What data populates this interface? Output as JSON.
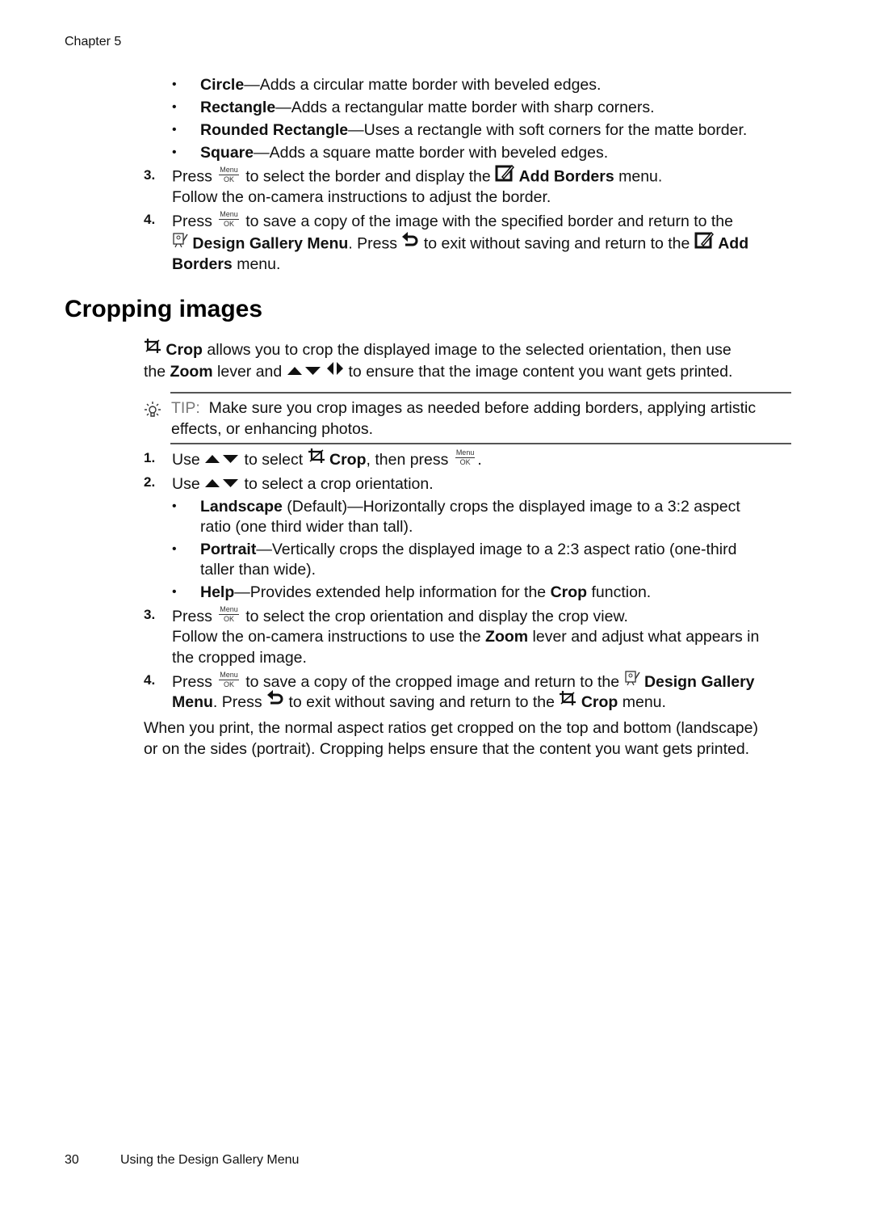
{
  "header": {
    "chapter": "Chapter 5"
  },
  "borders_section": {
    "bullets": [
      {
        "term": "Circle",
        "desc": "—Adds a circular matte border with beveled edges."
      },
      {
        "term": "Rectangle",
        "desc": "—Adds a rectangular matte border with sharp corners."
      },
      {
        "term": "Rounded Rectangle",
        "desc": "—Uses a rectangle with soft corners for the matte border."
      },
      {
        "term": "Square",
        "desc": "—Adds a square matte border with beveled edges."
      }
    ],
    "step3": {
      "num": "3.",
      "press": "Press",
      "after_button": "to select the border and display the",
      "menu_name": "Add Borders",
      "menu_suffix": "menu.",
      "line2": "Follow the on-camera instructions to adjust the border."
    },
    "step4": {
      "num": "4.",
      "press": "Press",
      "after_button": "to save a copy of the image with the specified border and return to the",
      "menu_name": "Design Gallery Menu",
      "press2": ". Press",
      "after_back": "to exit without saving and return to the",
      "menu2_a": "Add",
      "menu2_b": "Borders",
      "menu2_suffix": "menu."
    }
  },
  "crop_section": {
    "title": "Cropping images",
    "intro": {
      "crop": "Crop",
      "l1_rest": "allows you to crop the displayed image to the selected orientation, then use",
      "l2_the": "the",
      "zoom": "Zoom",
      "l2_mid": "lever and",
      "l2_rest": "to ensure that the image content you want gets printed."
    },
    "tip": {
      "label": "TIP:",
      "line1": "Make sure you crop images as needed before adding borders, applying artistic",
      "line2": "effects, or enhancing photos."
    },
    "step1": {
      "num": "1.",
      "use": "Use",
      "to_select": "to select",
      "crop": "Crop",
      "then_press": ", then press",
      "end": "."
    },
    "step2": {
      "num": "2.",
      "use": "Use",
      "rest": "to select a crop orientation."
    },
    "options": [
      {
        "term": "Landscape",
        "l1": "(Default)—Horizontally crops the displayed image to a 3:2 aspect",
        "l2": "ratio (one third wider than tall)."
      },
      {
        "term": "Portrait",
        "l1": "—Vertically crops the displayed image to a 2:3 aspect ratio (one-third",
        "l2": "taller than wide)."
      },
      {
        "term": "Help",
        "l1a": "—Provides extended help information for the",
        "crop": "Crop",
        "l1b": "function."
      }
    ],
    "step3": {
      "num": "3.",
      "press": "Press",
      "rest": "to select the crop orientation and display the crop view.",
      "l2a": "Follow the on-camera instructions to use the",
      "zoom": "Zoom",
      "l2b": "lever and adjust what appears in",
      "l3": "the cropped image."
    },
    "step4": {
      "num": "4.",
      "press": "Press",
      "rest": "to save a copy of the cropped image and return to the",
      "menu_a": "Design Gallery",
      "menu_b": "Menu",
      "press2": ". Press",
      "after_back": "to exit without saving and return to the",
      "crop": "Crop",
      "suffix": "menu."
    },
    "closing": {
      "l1": "When you print, the normal aspect ratios get cropped on the top and bottom (landscape)",
      "l2": "or on the sides (portrait). Cropping helps ensure that the content you want gets printed."
    }
  },
  "buttons": {
    "menu_top": "Menu",
    "menu_bottom": "OK"
  },
  "footer": {
    "page_number": "30",
    "section_title": "Using the Design Gallery Menu"
  }
}
